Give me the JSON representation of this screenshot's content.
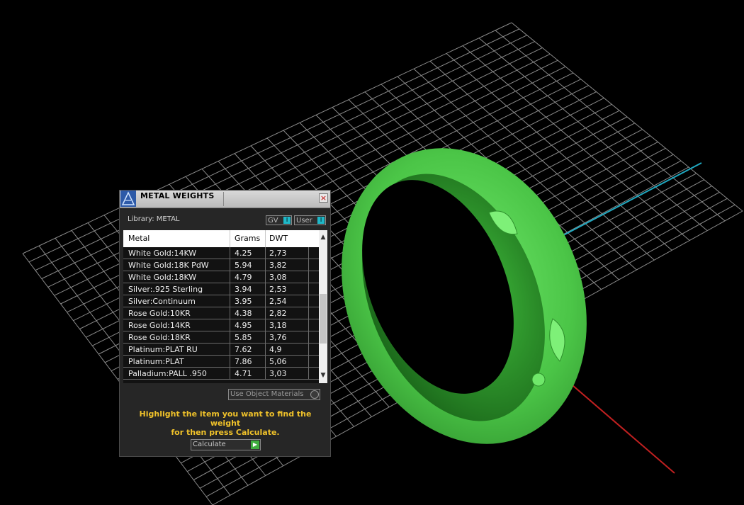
{
  "dialog": {
    "title": "METAL WEIGHTS",
    "close_glyph": "×",
    "library_label": "Library: METAL",
    "toggles": [
      {
        "label": "GV",
        "knob": "I"
      },
      {
        "label": "User",
        "knob": "I"
      }
    ],
    "table": {
      "headers": [
        "Metal",
        "Grams",
        "DWT"
      ],
      "rows": [
        {
          "metal": "White Gold:14KW",
          "grams": "4.25",
          "dwt": "2,73"
        },
        {
          "metal": "White Gold:18K PdW",
          "grams": "5.94",
          "dwt": "3,82"
        },
        {
          "metal": "White Gold:18KW",
          "grams": "4.79",
          "dwt": "3,08"
        },
        {
          "metal": "Silver:.925 Sterling",
          "grams": "3.94",
          "dwt": "2,53"
        },
        {
          "metal": "Silver:Continuum",
          "grams": "3.95",
          "dwt": "2,54"
        },
        {
          "metal": "Rose Gold:10KR",
          "grams": "4.38",
          "dwt": "2,82"
        },
        {
          "metal": "Rose Gold:14KR",
          "grams": "4.95",
          "dwt": "3,18"
        },
        {
          "metal": "Rose Gold:18KR",
          "grams": "5.85",
          "dwt": "3,76"
        },
        {
          "metal": "Platinum:PLAT RU",
          "grams": "7.62",
          "dwt": "4,9"
        },
        {
          "metal": "Platinum:PLAT",
          "grams": "7.86",
          "dwt": "5,06"
        },
        {
          "metal": "Palladium:PALL .950",
          "grams": "4.71",
          "dwt": "3,03"
        }
      ]
    },
    "scroll_up": "▲",
    "scroll_down": "▼",
    "use_object_materials": "Use Object Materials",
    "help_text_line1": "Highlight the item you want to find the weight",
    "help_text_line2": "for then press Calculate.",
    "calculate_label": "Calculate",
    "calculate_icon": "play-icon"
  },
  "colors": {
    "viewport_bg": "#000000",
    "grid": "#8a8a8a",
    "axis_red": "#c02020",
    "axis_cyan": "#20a8c0",
    "ring_green": "#5ed65a",
    "help_text": "#f0c22a"
  }
}
